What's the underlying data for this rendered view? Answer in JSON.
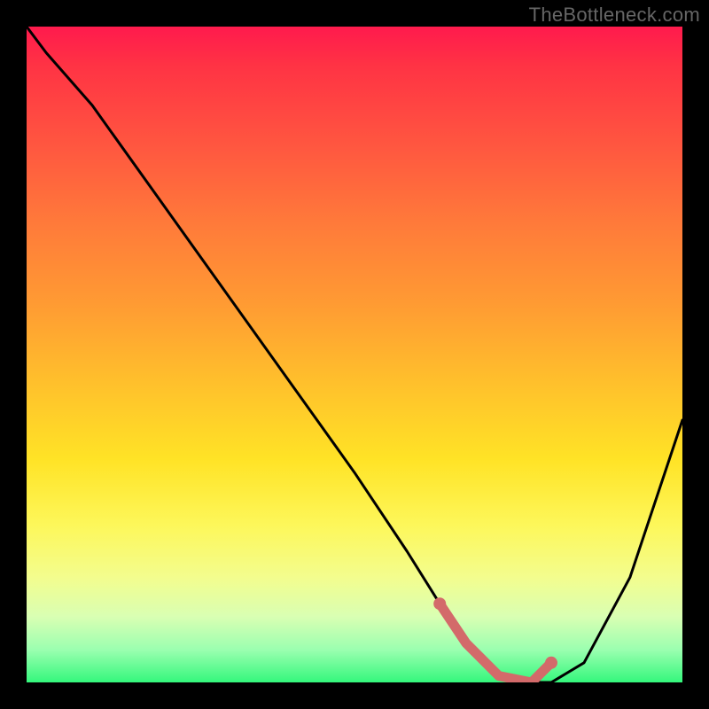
{
  "watermark": "TheBottleneck.com",
  "chart_data": {
    "type": "line",
    "title": "",
    "xlabel": "",
    "ylabel": "",
    "xlim": [
      0,
      100
    ],
    "ylim": [
      0,
      100
    ],
    "grid": false,
    "legend": false,
    "series": [
      {
        "name": "bottleneck-curve",
        "x": [
          0,
          3,
          10,
          20,
          30,
          40,
          50,
          58,
          63,
          67,
          72,
          77,
          80,
          85,
          92,
          100
        ],
        "y": [
          100,
          96,
          88,
          74,
          60,
          46,
          32,
          20,
          12,
          6,
          1,
          0,
          0,
          3,
          16,
          40
        ]
      }
    ],
    "highlight": {
      "name": "optimal-zone",
      "color": "#d36a6a",
      "points_x": [
        63,
        67,
        72,
        77,
        80
      ],
      "points_y": [
        12,
        6,
        1,
        0,
        3
      ]
    },
    "background_gradient": {
      "top": "#ff1a4d",
      "bottom": "#34f77c"
    }
  }
}
